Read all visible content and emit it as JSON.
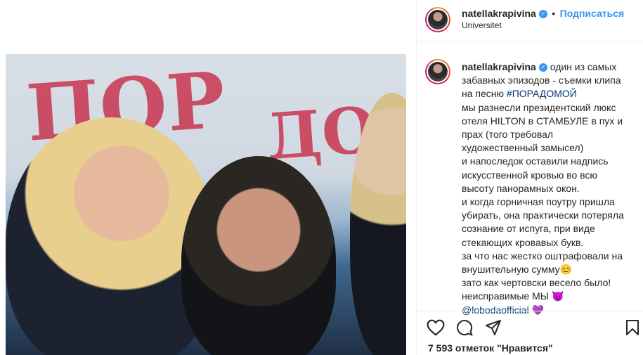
{
  "post": {
    "username": "natellakrapivina",
    "follow_label": "Подписаться",
    "separator": "•",
    "location": "Universitet",
    "verified_mark": "✓"
  },
  "caption": {
    "username": "natellakrapivina",
    "lines": [
      "один из самых",
      "забавных эпизодов - съемки клипа",
      "на песню ",
      "мы разнесли президентский люкс",
      "отеля HILTON в СТАМБУЛЕ в пух и",
      "прах (того требовал",
      "художественный замысел)",
      "и напоследок оставили надпись",
      "искусственной кровью во всю",
      "высоту панорамных окон.",
      "и когда горничная поутру пришла",
      "убирать, она практически потеряла",
      "сознание от испуга, при виде",
      "стекающих кровавых букв.",
      "за что нас жестко оштрафовали на",
      "внушительную сумму😊",
      "зато как чертовски весело было!",
      "неисправимые МЫ 😈"
    ],
    "hashtag": "#ПОРАДОМОЙ",
    "mention": "@lobodaofficial",
    "mention_emoji": "💜"
  },
  "likes": {
    "text": "7 593 отметок \"Нравится\""
  },
  "icons": [
    "heart-icon",
    "comment-icon",
    "share-icon",
    "bookmark-icon",
    "verified-badge-icon"
  ],
  "colors": {
    "accent": "#3897f0",
    "link": "#00376b",
    "text": "#262626",
    "divider": "#efefef"
  }
}
